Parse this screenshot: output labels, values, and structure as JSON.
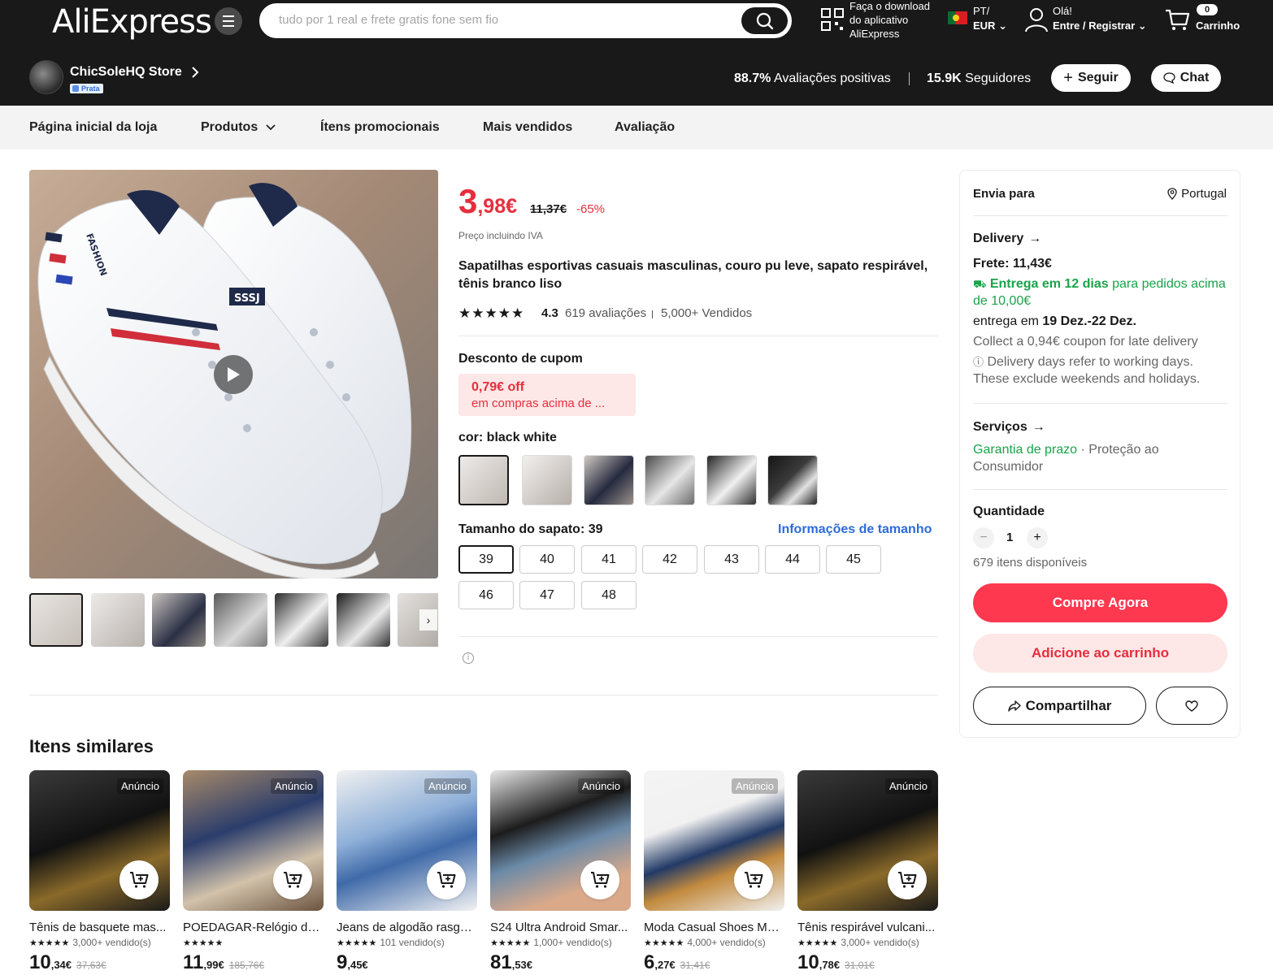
{
  "header": {
    "logo": "AliExpress",
    "search_placeholder": "tudo por 1 real e frete gratis fone sem fio",
    "app_download": "Faça o download do aplicativo AliExpress",
    "lang_top": "PT/",
    "lang_bottom": "EUR",
    "greeting": "Olá!",
    "account_action": "Entre / Registrar",
    "cart_count": "0",
    "cart_label": "Carrinho"
  },
  "store": {
    "name": "ChicSoleHQ Store",
    "badge": "Prata",
    "positive_pct": "88.7%",
    "positive_label": "Avaliações positivas",
    "followers_count": "15.9K",
    "followers_label": "Seguidores",
    "follow_label": "Seguir",
    "chat_label": "Chat"
  },
  "store_nav": [
    "Página inicial da loja",
    "Produtos",
    "Ítens promocionais",
    "Mais vendidos",
    "Avaliação"
  ],
  "product": {
    "price_int": "3",
    "price_dec": ",98€",
    "original_price": "11,37€",
    "discount": "-65%",
    "vat_note": "Preço incluindo IVA",
    "title": "Sapatilhas esportivas casuais masculinas, couro pu leve, sapato respirável, tênis branco liso",
    "rating_stars": "★★★★★",
    "rating": "4.3",
    "reviews": "619 avaliações",
    "sold": "5,000+ Vendidos",
    "coupon_label": "Desconto de cupom",
    "coupon_value": "0,79€ off",
    "coupon_condition": "em compras acima de ...",
    "color_label": "cor: black white",
    "size_label": "Tamanho do sapato: 39",
    "size_info": "Informações de tamanho",
    "sizes": [
      "39",
      "40",
      "41",
      "42",
      "43",
      "44",
      "45",
      "46",
      "47",
      "48"
    ]
  },
  "panel": {
    "ship_to": "Envia para",
    "country": "Portugal",
    "delivery_title": "Delivery",
    "shipping": "Frete: 11,43€",
    "delivery_fast": "Entrega em 12 dias",
    "delivery_fast_rest": "para pedidos acima de 10,00€",
    "delivery_pre": "entrega em",
    "delivery_dates": "19 Dez.-22 Dez.",
    "coupon_late": "Collect a 0,94€ coupon for late delivery",
    "delivery_note": "Delivery days refer to working days. These exclude weekends and holidays.",
    "services_title": "Serviços",
    "service_green": "Garantia de prazo",
    "service_rest": "· Proteção ao Consumidor",
    "qty_title": "Quantidade",
    "qty_value": "1",
    "available": "679 itens disponíveis",
    "buy_now": "Compre Agora",
    "add_cart": "Adicione ao carrinho",
    "share": "Compartilhar"
  },
  "similar": {
    "title": "Itens similares",
    "ad_label": "Anúncio",
    "items": [
      {
        "name": "Tênis de basquete mas...",
        "stars": "★★★★★",
        "sold": "3,000+ vendido(s)",
        "price_int": "10",
        "price_dec": ",34€",
        "price_old": "37,63€"
      },
      {
        "name": "POEDAGAR-Relógio de ...",
        "stars": "★★★★★",
        "sold": "",
        "price_int": "11",
        "price_dec": ",99€",
        "price_old": "185,76€"
      },
      {
        "name": "Jeans de algodão rasga...",
        "stars": "★★★★★",
        "sold": "101 vendido(s)",
        "price_int": "9",
        "price_dec": ",45€",
        "price_old": ""
      },
      {
        "name": "S24 Ultra Android Smar...",
        "stars": "★★★★★",
        "sold": "1,000+ vendido(s)",
        "price_int": "81",
        "price_dec": ",53€",
        "price_old": ""
      },
      {
        "name": "Moda Casual Shoes Me...",
        "stars": "★★★★★",
        "sold": "4,000+ vendido(s)",
        "price_int": "6",
        "price_dec": ",27€",
        "price_old": "31,41€"
      },
      {
        "name": "Tênis respirável vulcani...",
        "stars": "★★★★★",
        "sold": "3,000+ vendido(s)",
        "price_int": "10",
        "price_dec": ",78€",
        "price_old": "31,01€"
      }
    ]
  },
  "colors": {
    "accent_red": "#e62e3c",
    "buy_red": "#fd384f",
    "header_bg": "#191919",
    "link_blue": "#2d6bd8",
    "delivery_green": "#1aa34a"
  }
}
